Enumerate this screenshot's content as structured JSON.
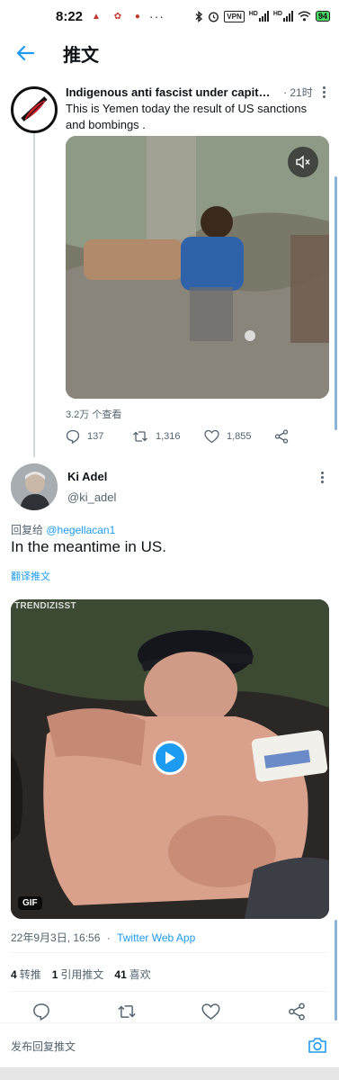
{
  "status_bar": {
    "time": "8:22",
    "notif_icons": "▲ ✿ ●",
    "vpn": "VPN",
    "hd1": "HD",
    "hd2": "HD",
    "battery": "94"
  },
  "header": {
    "title": "推文"
  },
  "tweet1": {
    "name": "Indigenous anti fascist under capitalis...",
    "time": "21时",
    "text": "This is Yemen today the result of US sanctions and bombings .",
    "views": "3.2万 个查看",
    "reply_count": "137",
    "retweet_count": "1,316",
    "like_count": "1,855"
  },
  "tweet2": {
    "name": "Ki Adel",
    "handle": "@ki_adel",
    "reply_prefix": "回复给",
    "reply_handle": "@hegellacan1",
    "text": "In the meantime in US.",
    "translate": "翻译推文",
    "gif_watermark": "TRENDIZISST",
    "gif_badge": "GIF",
    "date": "22年9月3日, 16:56",
    "sep": "·",
    "source": "Twitter Web App",
    "retweets_num": "4",
    "retweets_label": "转推",
    "quotes_num": "1",
    "quotes_label": "引用推文",
    "likes_num": "41",
    "likes_label": "喜欢"
  },
  "compose": {
    "placeholder": "发布回复推文"
  },
  "colors": {
    "accent": "#1d9bf0",
    "text": "#0f1419",
    "muted": "#536471"
  }
}
